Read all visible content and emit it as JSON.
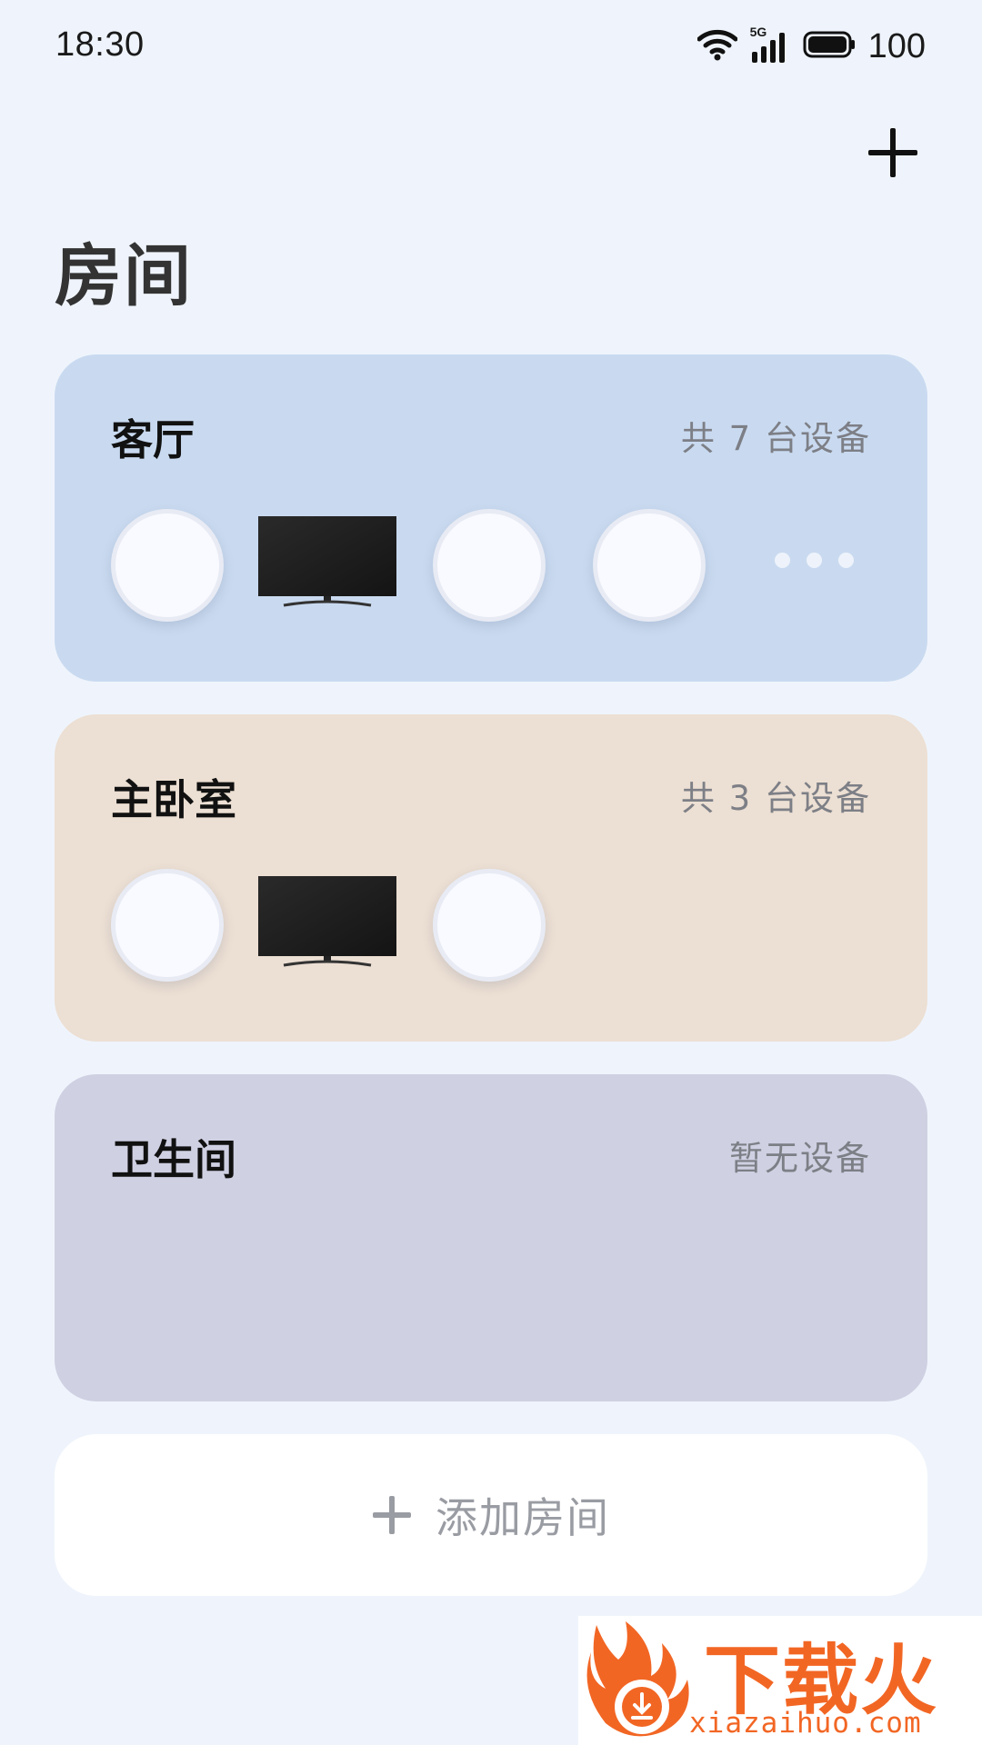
{
  "status_bar": {
    "time": "18:30",
    "network_label": "5G",
    "battery": "100"
  },
  "header": {
    "add_icon": "plus-icon",
    "title": "房间"
  },
  "rooms": [
    {
      "name": "客厅",
      "count_text": "共 7 台设备",
      "color": "#c9daf0",
      "devices": [
        "circle-device",
        "tv",
        "circle-device",
        "circle-device"
      ],
      "has_more": true
    },
    {
      "name": "主卧室",
      "count_text": "共 3 台设备",
      "color": "#ecdfd3",
      "devices": [
        "circle-device",
        "tv",
        "circle-device"
      ],
      "has_more": false
    },
    {
      "name": "卫生间",
      "count_text": "暂无设备",
      "color": "#cfd0e2",
      "devices": [],
      "has_more": false
    }
  ],
  "add_room": {
    "icon": "plus-icon",
    "label": "添加房间"
  },
  "watermark": {
    "brand": "下载火",
    "url": "xiazaihuo.com"
  }
}
